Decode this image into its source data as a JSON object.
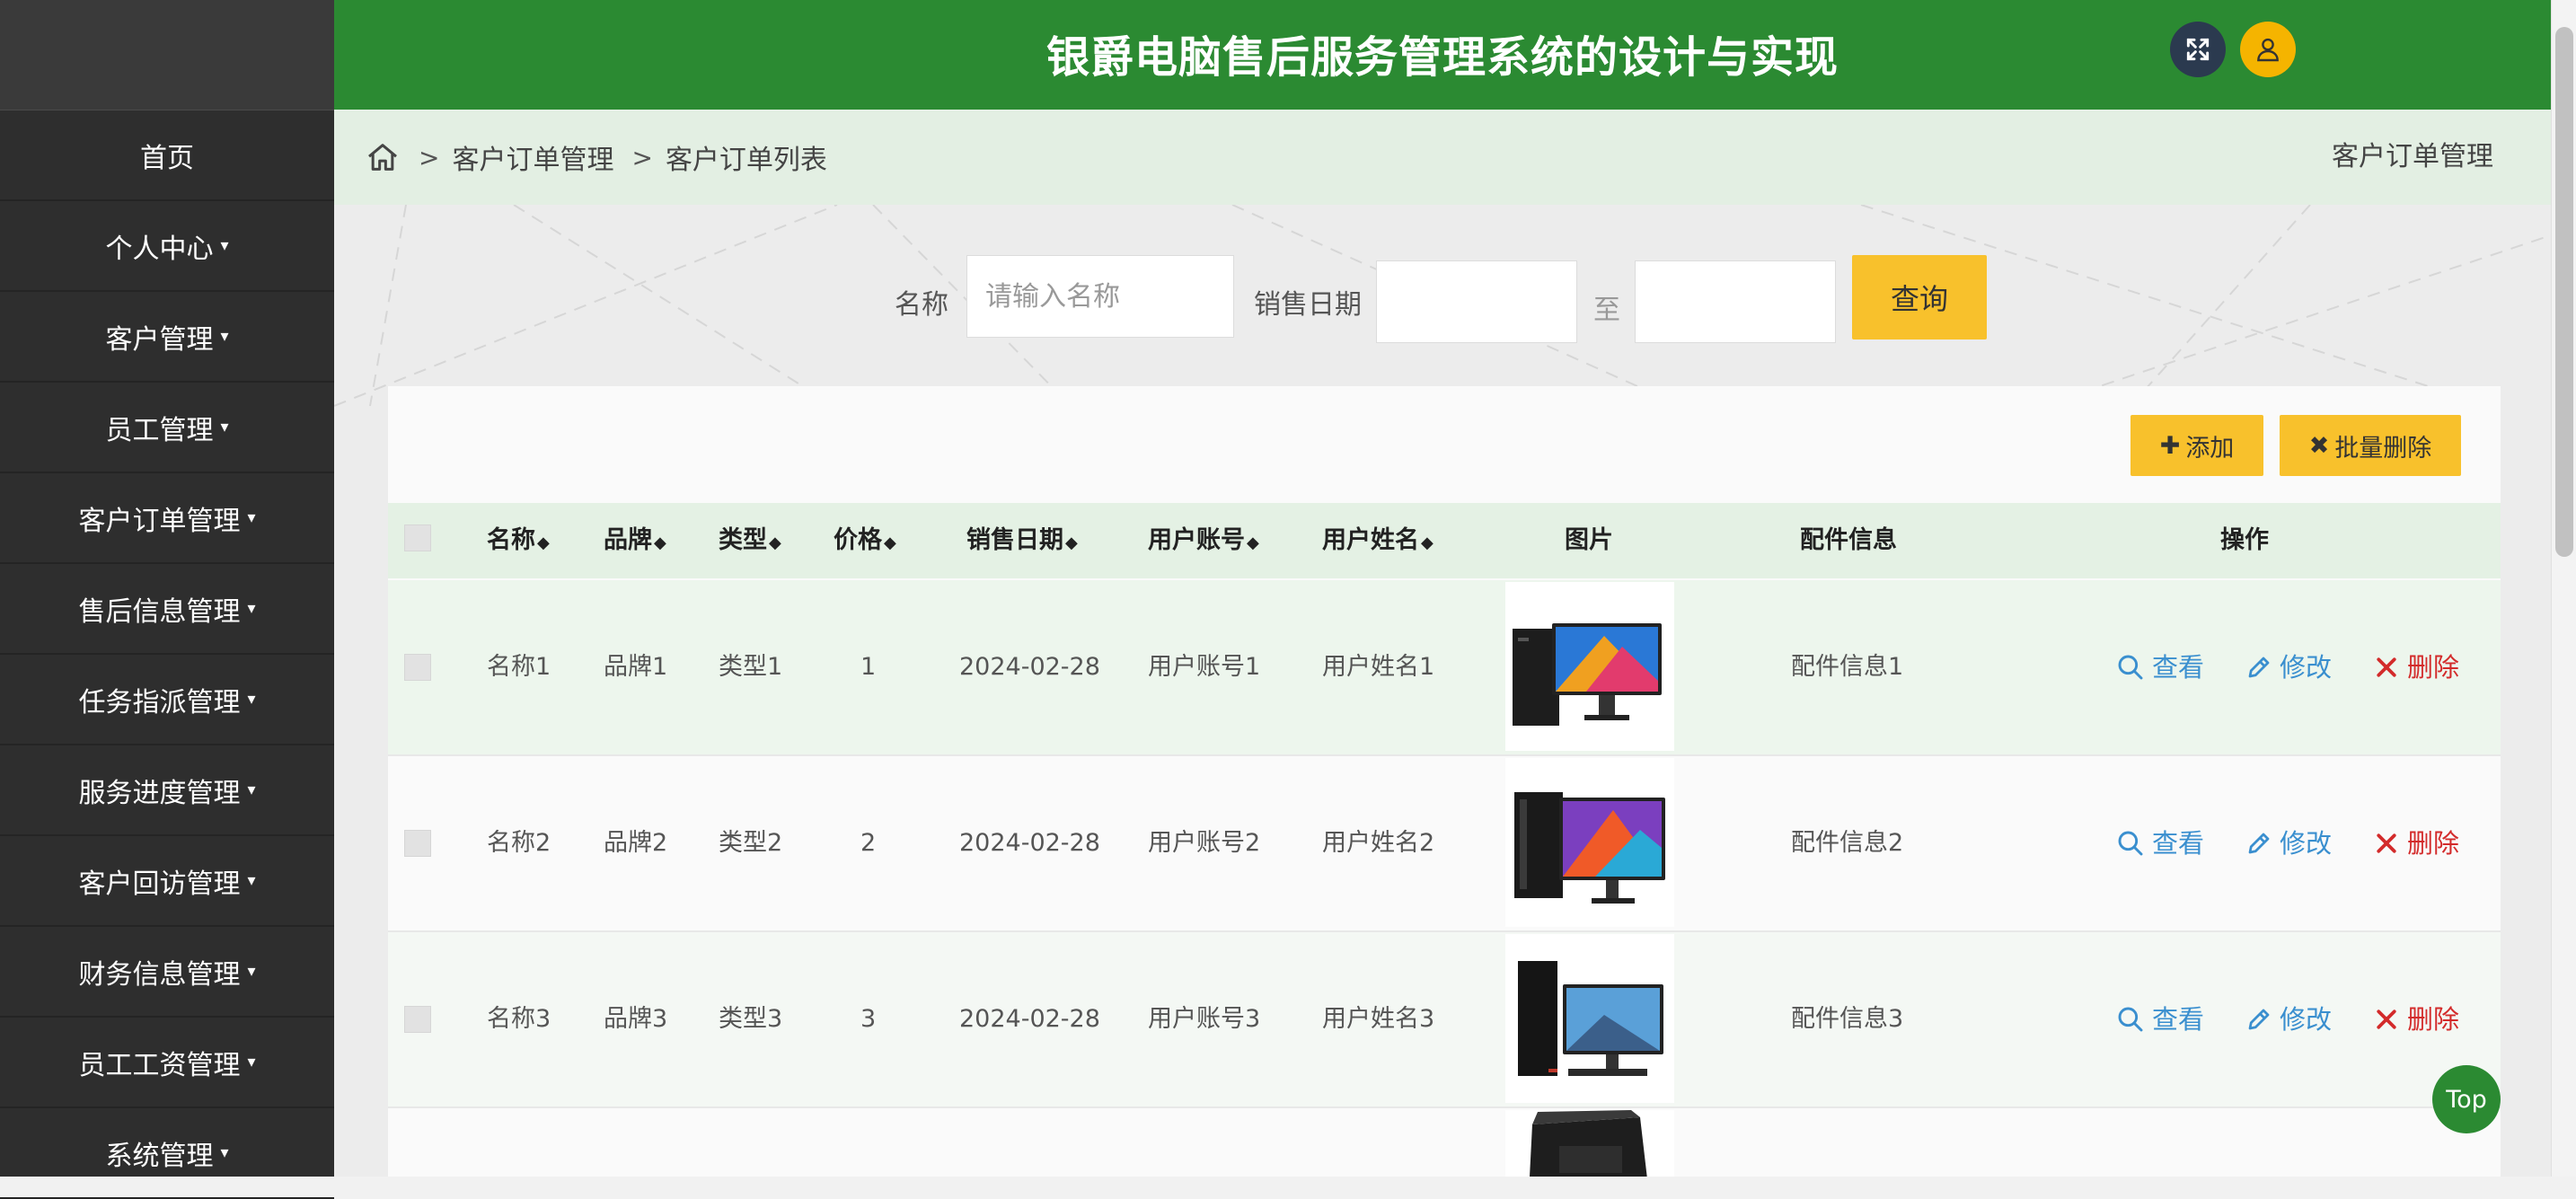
{
  "app": {
    "title": "银爵电脑售后服务管理系统的设计与实现"
  },
  "colors": {
    "header_bg": "#2b8a32",
    "sidebar_bg": "#2e2e2e",
    "accent_yellow": "#f8c12c",
    "link_blue": "#3a8fcf",
    "delete_red": "#d32b2b"
  },
  "sidebar": {
    "items": [
      {
        "label": "首页",
        "caret": ""
      },
      {
        "label": "个人中心",
        "caret": "▾"
      },
      {
        "label": "客户管理",
        "caret": "▾"
      },
      {
        "label": "员工管理",
        "caret": "▾"
      },
      {
        "label": "客户订单管理",
        "caret": "▾"
      },
      {
        "label": "售后信息管理",
        "caret": "▾"
      },
      {
        "label": "任务指派管理",
        "caret": "▾"
      },
      {
        "label": "服务进度管理",
        "caret": "▾"
      },
      {
        "label": "客户回访管理",
        "caret": "▾"
      },
      {
        "label": "财务信息管理",
        "caret": "▾"
      },
      {
        "label": "员工工资管理",
        "caret": "▾"
      },
      {
        "label": "系统管理",
        "caret": "▾"
      }
    ]
  },
  "breadcrumb": {
    "sep": ">",
    "items": [
      "客户订单管理",
      "客户订单列表"
    ],
    "right_title": "客户订单管理"
  },
  "search": {
    "name_label": "名称",
    "name_placeholder": "请输入名称",
    "name_value": "",
    "date_label": "销售日期",
    "date_from": "",
    "date_to_label": "至",
    "date_to": "",
    "query_label": "查询"
  },
  "toolbar": {
    "add_label": "添加",
    "batch_delete_label": "批量删除"
  },
  "table": {
    "columns": [
      "名称",
      "品牌",
      "类型",
      "价格",
      "销售日期",
      "用户账号",
      "用户姓名",
      "图片",
      "配件信息",
      "操作"
    ],
    "sort_icon": "◆",
    "actions": {
      "view": "查看",
      "edit": "修改",
      "delete": "删除"
    },
    "rows": [
      {
        "name": "名称1",
        "brand": "品牌1",
        "type": "类型1",
        "price": "1",
        "date": "2024-02-28",
        "account": "用户账号1",
        "username": "用户姓名1",
        "image": "desktop-pc-image",
        "parts": "配件信息1"
      },
      {
        "name": "名称2",
        "brand": "品牌2",
        "type": "类型2",
        "price": "2",
        "date": "2024-02-28",
        "account": "用户账号2",
        "username": "用户姓名2",
        "image": "desktop-pc-image",
        "parts": "配件信息2"
      },
      {
        "name": "名称3",
        "brand": "品牌3",
        "type": "类型3",
        "price": "3",
        "date": "2024-02-28",
        "account": "用户账号3",
        "username": "用户姓名3",
        "image": "desktop-pc-image",
        "parts": "配件信息3"
      }
    ]
  },
  "top_button": "Top"
}
